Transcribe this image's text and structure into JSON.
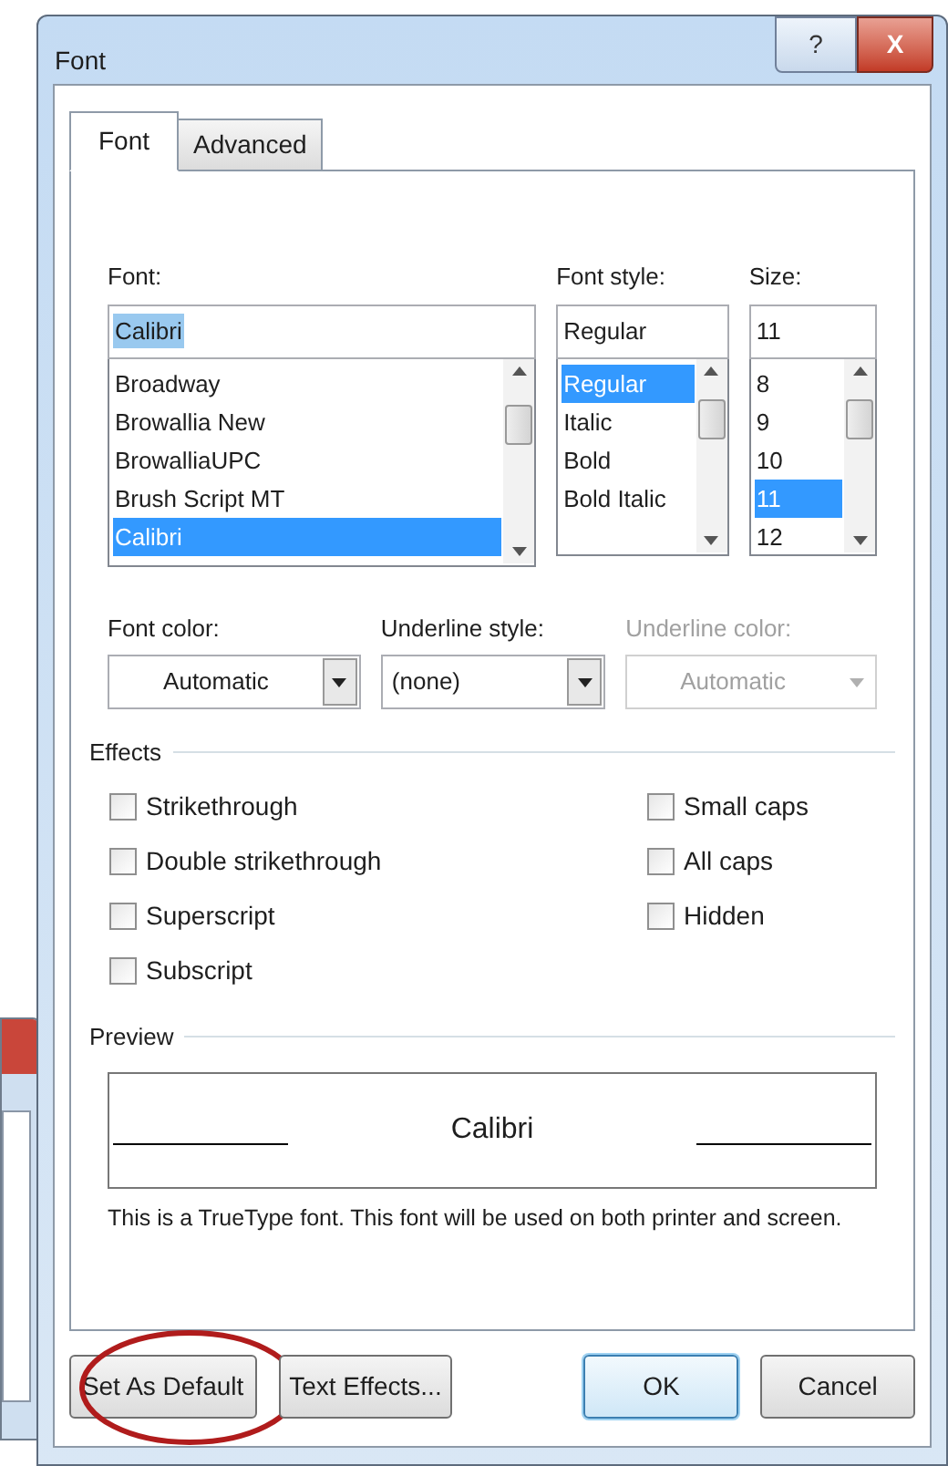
{
  "window": {
    "title": "Font",
    "help": "?",
    "close": "X"
  },
  "tabs": [
    {
      "label": "Font",
      "selected": true
    },
    {
      "label": "Advanced",
      "selected": false
    }
  ],
  "pickers": [
    {
      "label": "Font:",
      "value": "Calibri",
      "value_selected": true,
      "items": [
        {
          "label": "Broadway",
          "selected": false
        },
        {
          "label": "Browallia New",
          "selected": false
        },
        {
          "label": "BrowalliaUPC",
          "selected": false
        },
        {
          "label": "Brush Script MT",
          "selected": false
        },
        {
          "label": "Calibri",
          "selected": true
        }
      ]
    },
    {
      "label": "Font style:",
      "value": "Regular",
      "value_selected": false,
      "items": [
        {
          "label": "Regular",
          "selected": true
        },
        {
          "label": "Italic",
          "selected": false
        },
        {
          "label": "Bold",
          "selected": false
        },
        {
          "label": "Bold Italic",
          "selected": false
        }
      ]
    },
    {
      "label": "Size:",
      "value": "11",
      "value_selected": false,
      "items": [
        {
          "label": "8",
          "selected": false
        },
        {
          "label": "9",
          "selected": false
        },
        {
          "label": "10",
          "selected": false
        },
        {
          "label": "11",
          "selected": true
        },
        {
          "label": "12",
          "selected": false
        }
      ]
    }
  ],
  "combos": [
    {
      "label": "Font color:",
      "value": "Automatic",
      "disabled": false
    },
    {
      "label": "Underline style:",
      "value": "(none)",
      "disabled": false
    },
    {
      "label": "Underline color:",
      "value": "Automatic",
      "disabled": true
    }
  ],
  "effects": {
    "title": "Effects",
    "columns": [
      [
        {
          "label": "Strikethrough",
          "checked": false
        },
        {
          "label": "Double strikethrough",
          "checked": false
        },
        {
          "label": "Superscript",
          "checked": false
        },
        {
          "label": "Subscript",
          "checked": false
        }
      ],
      [
        {
          "label": "Small caps",
          "checked": false
        },
        {
          "label": "All caps",
          "checked": false
        },
        {
          "label": "Hidden",
          "checked": false
        }
      ]
    ]
  },
  "preview": {
    "title": "Preview",
    "sample": "Calibri",
    "note": "This is a TrueType font. This font will be used on both printer and screen."
  },
  "buttons": [
    {
      "label": "Set As Default",
      "default": false,
      "circled": true
    },
    {
      "label": "Text Effects...",
      "default": false,
      "circled": false
    },
    {
      "label": "OK",
      "default": true,
      "circled": false
    },
    {
      "label": "Cancel",
      "default": false,
      "circled": false
    }
  ]
}
